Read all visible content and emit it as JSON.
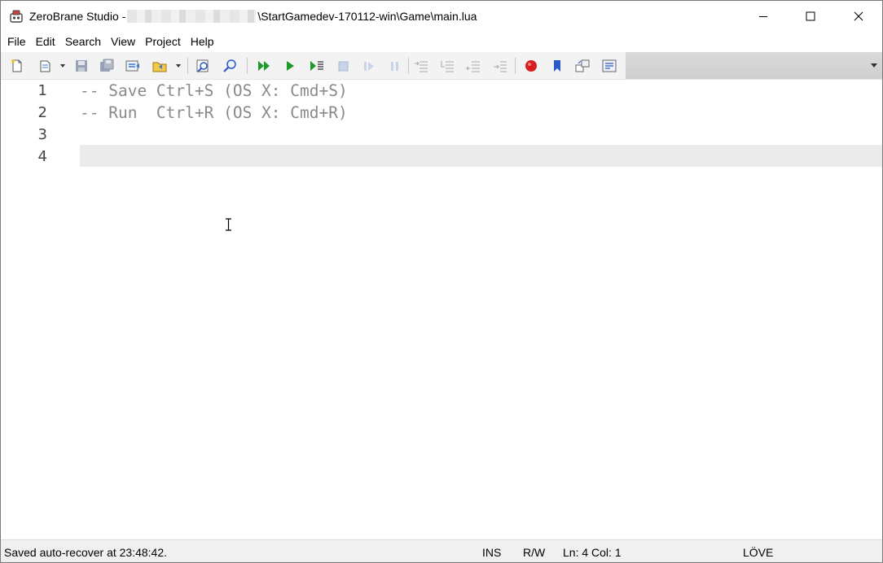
{
  "window": {
    "app_name": "ZeroBrane Studio",
    "title_separator": "-",
    "title_path_suffix": "\\StartGamedev-170112-win\\Game\\main.lua"
  },
  "menu": [
    "File",
    "Edit",
    "Search",
    "View",
    "Project",
    "Help"
  ],
  "toolbar": {
    "icons": [
      "new-file-icon",
      "open-file-icon",
      "save-icon",
      "save-all-icon",
      "project-directory-icon",
      "project-recent-icon",
      "find-icon",
      "find-in-files-icon",
      "run-project-icon",
      "start-debug-icon",
      "run-to-cursor-icon",
      "stop-icon",
      "break-icon",
      "pause-icon",
      "step-over-icon",
      "step-into-icon",
      "step-out-icon",
      "step-next-icon",
      "toggle-breakpoint-icon",
      "toggle-bookmark-icon",
      "compile-icon",
      "output-icon"
    ]
  },
  "editor": {
    "line_numbers": [
      "1",
      "2",
      "3",
      "4"
    ],
    "lines": [
      "-- Save Ctrl+S (OS X: Cmd+S)",
      "-- Run  Ctrl+R (OS X: Cmd+R)",
      "",
      ""
    ],
    "current_line": 4
  },
  "status": {
    "message": "Saved auto-recover at 23:48:42.",
    "insert_mode": "INS",
    "access_mode": "R/W",
    "position": "Ln: 4 Col: 1",
    "interpreter": "LÖVE"
  },
  "colors": {
    "comment": "#8a8a8a",
    "current_line_bg": "#ebebeb",
    "toolbar_green": "#1f9a2a",
    "breakpoint_red": "#d81e1e",
    "bookmark_blue": "#2b57c9"
  }
}
